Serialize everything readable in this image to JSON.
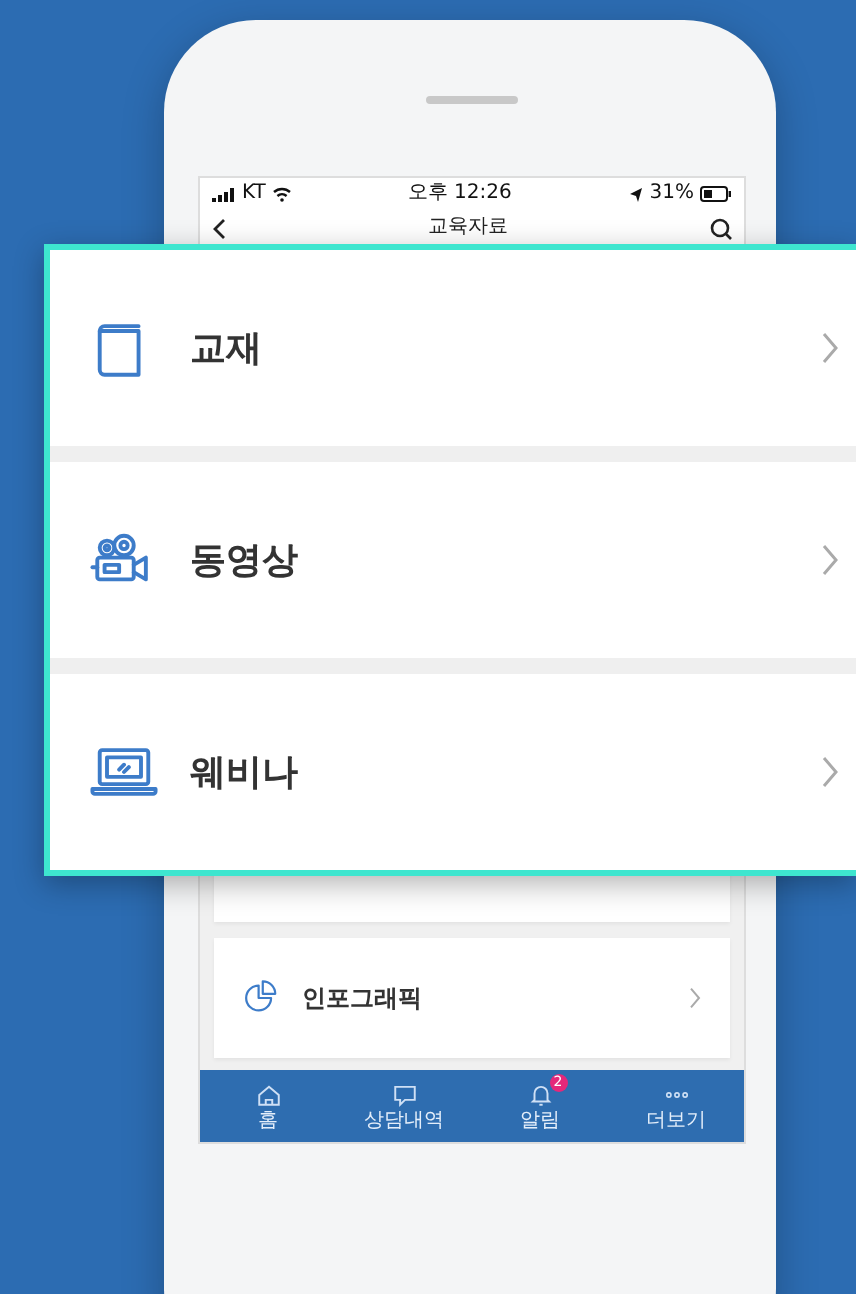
{
  "status_bar": {
    "carrier": "KT",
    "time": "오후 12:26",
    "battery": "31%"
  },
  "nav": {
    "title": "교육자료"
  },
  "screen_items": [
    {
      "kind": "blank"
    },
    {
      "kind": "pie",
      "label": "인포그래픽"
    }
  ],
  "overlay_items": [
    {
      "kind": "book",
      "label": "교재"
    },
    {
      "kind": "camera",
      "label": "동영상"
    },
    {
      "kind": "laptop",
      "label": "웨비나"
    }
  ],
  "tab_bar": [
    {
      "kind": "home",
      "label": "홈"
    },
    {
      "kind": "chat",
      "label": "상담내역"
    },
    {
      "kind": "bell",
      "label": "알림",
      "badge": "2"
    },
    {
      "kind": "more",
      "label": "더보기"
    }
  ]
}
